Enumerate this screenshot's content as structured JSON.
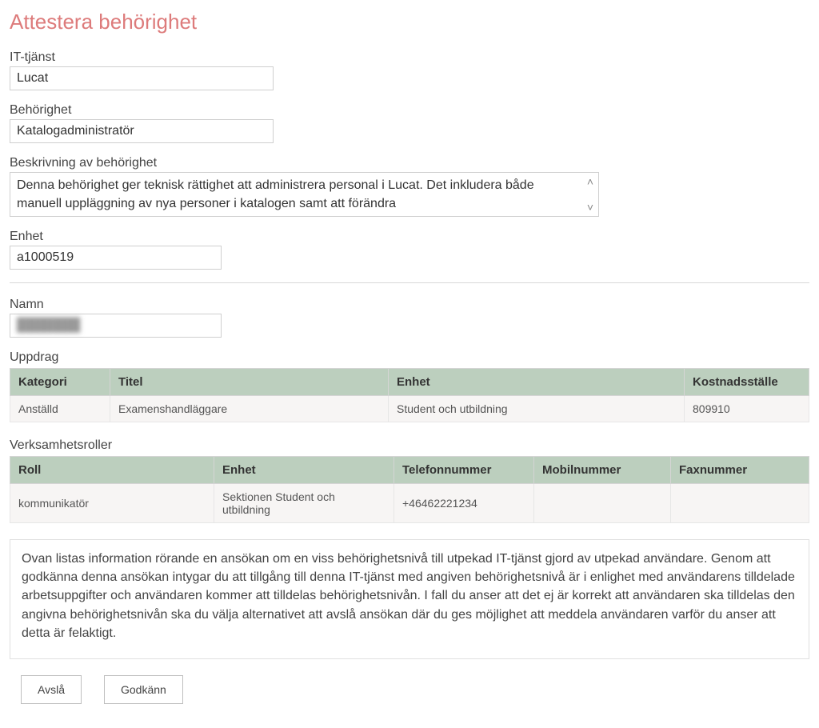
{
  "page_title": "Attestera behörighet",
  "fields": {
    "it_service": {
      "label": "IT-tjänst",
      "value": "Lucat"
    },
    "permission": {
      "label": "Behörighet",
      "value": "Katalogadministratör"
    },
    "permission_desc": {
      "label": "Beskrivning av behörighet",
      "value": "Denna behörighet ger teknisk rättighet att administrera personal i Lucat. Det inkludera både manuell uppläggning av nya personer i katalogen samt att förändra"
    },
    "unit": {
      "label": "Enhet",
      "value": "a1000519"
    },
    "name": {
      "label": "Namn",
      "value": "███████"
    }
  },
  "uppdrag": {
    "label": "Uppdrag",
    "headers": [
      "Kategori",
      "Titel",
      "Enhet",
      "Kostnadsställe"
    ],
    "rows": [
      {
        "kategori": "Anställd",
        "titel": "Examenshandläggare",
        "enhet": "Student och utbildning",
        "kostnad": "809910"
      }
    ],
    "col_widths": [
      "125px",
      "348px",
      "370px",
      "auto"
    ]
  },
  "roller": {
    "label": "Verksamhetsroller",
    "headers": [
      "Roll",
      "Enhet",
      "Telefonnummer",
      "Mobilnummer",
      "Faxnummer"
    ],
    "rows": [
      {
        "roll": "kommunikatör",
        "enhet": "Sektionen Student och utbildning",
        "tel": "+46462221234",
        "mobil": "",
        "fax": ""
      }
    ]
  },
  "info_text": "Ovan listas information rörande en ansökan om en viss behörighetsnivå till utpekad IT-tjänst gjord av utpekad användare. Genom att godkänna denna ansökan intygar du att tillgång till denna IT-tjänst med angiven behörighetsnivå är i enlighet med användarens tilldelade arbetsuppgifter och användaren kommer att tilldelas behörighetsnivån. I fall du anser att det ej är korrekt att användaren ska tilldelas den angivna behörighetsnivån ska du välja alternativet att avslå ansökan där du ges möjlighet att meddela användaren varför du anser att detta är felaktigt.",
  "buttons": {
    "reject": "Avslå",
    "approve": "Godkänn"
  }
}
